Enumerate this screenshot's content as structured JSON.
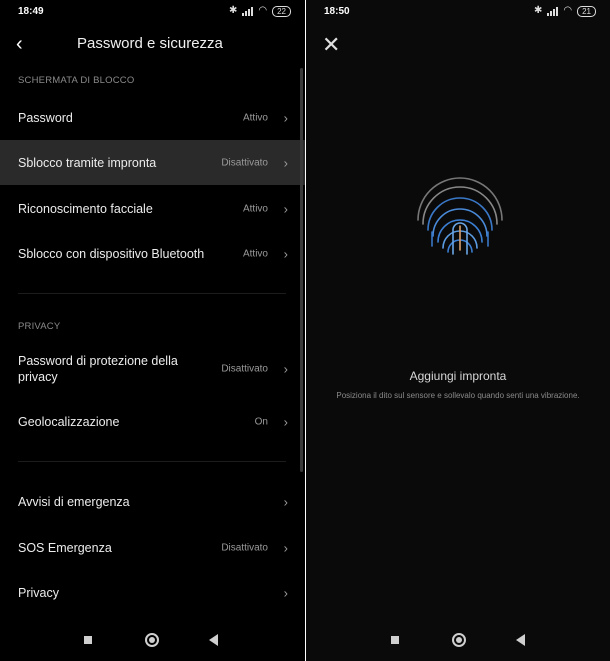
{
  "left": {
    "status": {
      "time": "18:49",
      "battery": "22"
    },
    "header": {
      "title": "Password e sicurezza"
    },
    "sections": {
      "lock": "SCHERMATA DI BLOCCO",
      "privacy": "PRIVACY"
    },
    "rows": {
      "password": {
        "label": "Password",
        "value": "Attivo"
      },
      "fingerprint": {
        "label": "Sblocco tramite impronta",
        "value": "Disattivato"
      },
      "face": {
        "label": "Riconoscimento facciale",
        "value": "Attivo"
      },
      "bluetooth": {
        "label": "Sblocco con dispositivo Bluetooth",
        "value": "Attivo"
      },
      "privacy_password": {
        "label": "Password di protezione della privacy",
        "value": "Disattivato"
      },
      "location": {
        "label": "Geolocalizzazione",
        "value": "On"
      },
      "emergency_alerts": {
        "label": "Avvisi di emergenza",
        "value": ""
      },
      "sos": {
        "label": "SOS Emergenza",
        "value": "Disattivato"
      },
      "privacy": {
        "label": "Privacy",
        "value": ""
      }
    }
  },
  "right": {
    "status": {
      "time": "18:50",
      "battery": "21"
    },
    "title": "Aggiungi impronta",
    "subtitle": "Posiziona il dito sul sensore e sollevalo quando senti una vibrazione.",
    "icons": {
      "close": "close-icon",
      "fingerprint": "fingerprint-icon"
    }
  },
  "colors": {
    "background": "#000000",
    "highlight": "#2a2a2a",
    "accent": "#3b7fd4"
  }
}
